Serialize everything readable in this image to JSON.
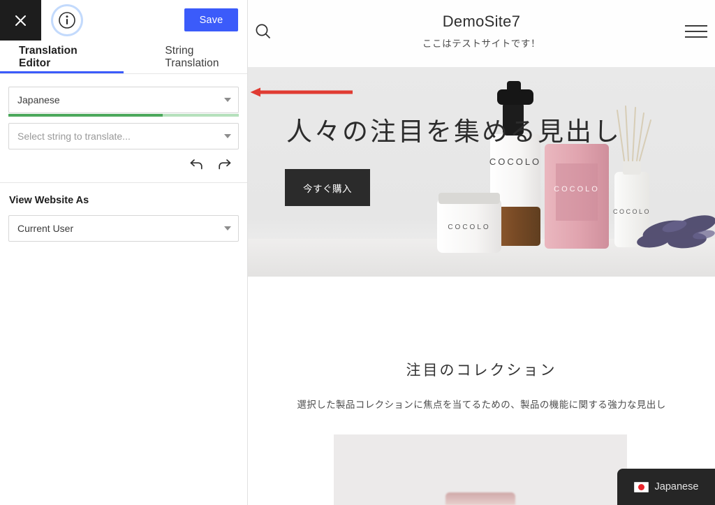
{
  "sidebar": {
    "toolbar": {
      "close_icon": "close-icon",
      "info_icon": "info-icon",
      "save_label": "Save"
    },
    "tabs": [
      {
        "label": "Translation Editor",
        "active": true
      },
      {
        "label": "String Translation",
        "active": false
      }
    ],
    "language_select": {
      "value": "Japanese",
      "progress_percent": 67,
      "progress_color": "#4ca85c",
      "progress_track_color": "#b5e0bc"
    },
    "string_select": {
      "placeholder": "Select string to translate...",
      "value": ""
    },
    "history": {
      "undo_icon": "undo-icon",
      "redo_icon": "redo-icon"
    },
    "view_website_as": {
      "label": "View Website As",
      "value": "Current User"
    }
  },
  "preview": {
    "header": {
      "search_icon": "search-icon",
      "title": "DemoSite7",
      "subtitle": "ここはテストサイトです！",
      "menu_icon": "hamburger-menu-icon"
    },
    "hero": {
      "headline": "人々の注目を集める見出し",
      "cta_label": "今すぐ購入",
      "product_brand": "COCOLO"
    },
    "featured": {
      "title": "注目のコレクション",
      "subtitle": "選択した製品コレクションに焦点を当てるための、製品の機能に関する強力な見出し"
    },
    "language_badge": {
      "label": "Japanese",
      "flag_icon": "flag-japan-icon"
    }
  },
  "annotation": {
    "arrow_icon": "arrow-left-annotation",
    "color": "#e03b32"
  },
  "theme": {
    "accent_blue": "#3b5bfa",
    "dark_panel": "#1d1d1d",
    "badge_dark": "#262626"
  }
}
